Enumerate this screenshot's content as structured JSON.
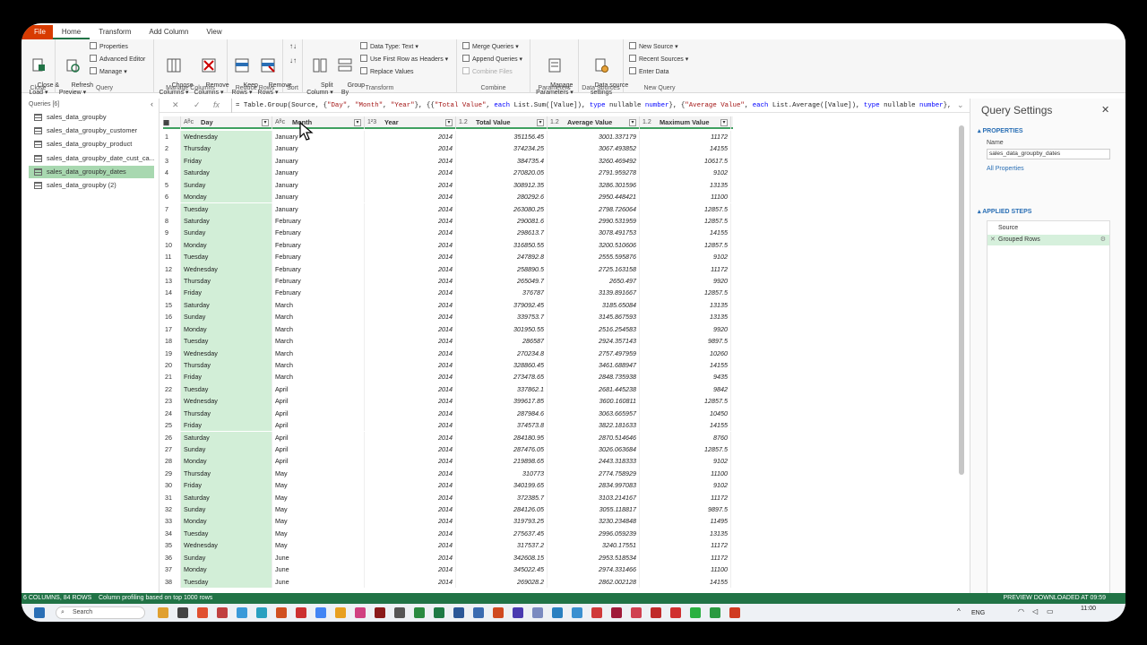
{
  "ribbon": {
    "tabs": [
      "File",
      "Home",
      "Transform",
      "Add Column",
      "View"
    ],
    "active_tab": "Home",
    "groups": {
      "close": {
        "label": "Close",
        "close_load": "Close &\nLoad ▾"
      },
      "query": {
        "label": "Query",
        "refresh": "Refresh\nPreview ▾",
        "properties": "Properties",
        "advanced_editor": "Advanced Editor",
        "manage": "Manage ▾"
      },
      "manage_columns": {
        "label": "Manage Columns",
        "choose": "Choose\nColumns ▾",
        "remove": "Remove\nColumns ▾"
      },
      "reduce_rows": {
        "label": "Reduce Rows",
        "keep": "Keep\nRows ▾",
        "remove": "Remove\nRows ▾"
      },
      "sort": {
        "label": "Sort"
      },
      "transform": {
        "label": "Transform",
        "split": "Split\nColumn ▾",
        "group": "Group\nBy",
        "data_type": "Data Type: Text ▾",
        "first_row": "Use First Row as Headers ▾",
        "replace": "Replace Values"
      },
      "combine": {
        "label": "Combine",
        "merge": "Merge Queries ▾",
        "append": "Append Queries ▾",
        "combine_files": "Combine Files"
      },
      "parameters": {
        "label": "Parameters",
        "manage": "Manage\nParameters ▾"
      },
      "data_sources": {
        "label": "Data Sources",
        "settings": "Data source\nsettings"
      },
      "new_query": {
        "label": "New Query",
        "new_source": "New Source ▾",
        "recent": "Recent Sources ▾",
        "enter": "Enter Data"
      }
    }
  },
  "formula_bar": {
    "fx": "fx",
    "formula_parts": [
      {
        "t": "= Table.Group(Source, {",
        "c": ""
      },
      {
        "t": "\"Day\"",
        "c": "s"
      },
      {
        "t": ", ",
        "c": ""
      },
      {
        "t": "\"Month\"",
        "c": "s"
      },
      {
        "t": ", ",
        "c": ""
      },
      {
        "t": "\"Year\"",
        "c": "s"
      },
      {
        "t": "}, {{",
        "c": ""
      },
      {
        "t": "\"Total Value\"",
        "c": "s"
      },
      {
        "t": ", ",
        "c": ""
      },
      {
        "t": "each",
        "c": "k"
      },
      {
        "t": " List.Sum([Value]), ",
        "c": ""
      },
      {
        "t": "type",
        "c": "k"
      },
      {
        "t": " nullable ",
        "c": ""
      },
      {
        "t": "number",
        "c": "k"
      },
      {
        "t": "}, {",
        "c": ""
      },
      {
        "t": "\"Average Value\"",
        "c": "s"
      },
      {
        "t": ", ",
        "c": ""
      },
      {
        "t": "each",
        "c": "k"
      },
      {
        "t": " List.Average([Value]), ",
        "c": ""
      },
      {
        "t": "type",
        "c": "k"
      },
      {
        "t": " nullable ",
        "c": ""
      },
      {
        "t": "number",
        "c": "k"
      },
      {
        "t": "},",
        "c": ""
      }
    ]
  },
  "queries": {
    "header": "Queries [6]",
    "items": [
      "sales_data_groupby",
      "sales_data_groupby_customer",
      "sales_data_groupby_product",
      "sales_data_groupby_date_cust_ca...",
      "sales_data_groupby_dates",
      "sales_data_groupby (2)"
    ],
    "selected": 4
  },
  "grid": {
    "columns": [
      {
        "type": "Aᴮᴄ",
        "name": "Day"
      },
      {
        "type": "Aᴮᴄ",
        "name": "Month"
      },
      {
        "type": "1²3",
        "name": "Year"
      },
      {
        "type": "1.2",
        "name": "Total Value"
      },
      {
        "type": "1.2",
        "name": "Average Value"
      },
      {
        "type": "1.2",
        "name": "Maximum Value"
      }
    ],
    "rows": [
      [
        "Wednesday",
        "January",
        "2014",
        "351156.45",
        "3001.337179",
        "11172"
      ],
      [
        "Thursday",
        "January",
        "2014",
        "374234.25",
        "3067.493852",
        "14155"
      ],
      [
        "Friday",
        "January",
        "2014",
        "384735.4",
        "3260.469492",
        "10617.5"
      ],
      [
        "Saturday",
        "January",
        "2014",
        "270820.05",
        "2791.959278",
        "9102"
      ],
      [
        "Sunday",
        "January",
        "2014",
        "308912.35",
        "3286.301596",
        "13135"
      ],
      [
        "Monday",
        "January",
        "2014",
        "280292.6",
        "2950.448421",
        "11100"
      ],
      [
        "Tuesday",
        "January",
        "2014",
        "263080.25",
        "2798.726064",
        "12857.5"
      ],
      [
        "Saturday",
        "February",
        "2014",
        "290081.6",
        "2990.531959",
        "12857.5"
      ],
      [
        "Sunday",
        "February",
        "2014",
        "298613.7",
        "3078.491753",
        "14155"
      ],
      [
        "Monday",
        "February",
        "2014",
        "316850.55",
        "3200.510606",
        "12857.5"
      ],
      [
        "Tuesday",
        "February",
        "2014",
        "247892.8",
        "2555.595876",
        "9102"
      ],
      [
        "Wednesday",
        "February",
        "2014",
        "258890.5",
        "2725.163158",
        "11172"
      ],
      [
        "Thursday",
        "February",
        "2014",
        "265049.7",
        "2650.497",
        "9920"
      ],
      [
        "Friday",
        "February",
        "2014",
        "376787",
        "3139.891667",
        "12857.5"
      ],
      [
        "Saturday",
        "March",
        "2014",
        "379092.45",
        "3185.65084",
        "13135"
      ],
      [
        "Sunday",
        "March",
        "2014",
        "339753.7",
        "3145.867593",
        "13135"
      ],
      [
        "Monday",
        "March",
        "2014",
        "301950.55",
        "2516.254583",
        "9920"
      ],
      [
        "Tuesday",
        "March",
        "2014",
        "286587",
        "2924.357143",
        "9897.5"
      ],
      [
        "Wednesday",
        "March",
        "2014",
        "270234.8",
        "2757.497959",
        "10260"
      ],
      [
        "Thursday",
        "March",
        "2014",
        "328860.45",
        "3461.688947",
        "14155"
      ],
      [
        "Friday",
        "March",
        "2014",
        "273478.65",
        "2848.735938",
        "9435"
      ],
      [
        "Tuesday",
        "April",
        "2014",
        "337862.1",
        "2681.445238",
        "9842"
      ],
      [
        "Wednesday",
        "April",
        "2014",
        "399617.85",
        "3600.160811",
        "12857.5"
      ],
      [
        "Thursday",
        "April",
        "2014",
        "287984.6",
        "3063.665957",
        "10450"
      ],
      [
        "Friday",
        "April",
        "2014",
        "374573.8",
        "3822.181633",
        "14155"
      ],
      [
        "Saturday",
        "April",
        "2014",
        "284180.95",
        "2870.514646",
        "8760"
      ],
      [
        "Sunday",
        "April",
        "2014",
        "287476.05",
        "3026.063684",
        "12857.5"
      ],
      [
        "Monday",
        "April",
        "2014",
        "219898.65",
        "2443.318333",
        "9102"
      ],
      [
        "Thursday",
        "May",
        "2014",
        "310773",
        "2774.758929",
        "11100"
      ],
      [
        "Friday",
        "May",
        "2014",
        "340199.65",
        "2834.997083",
        "9102"
      ],
      [
        "Saturday",
        "May",
        "2014",
        "372385.7",
        "3103.214167",
        "11172"
      ],
      [
        "Sunday",
        "May",
        "2014",
        "284126.05",
        "3055.118817",
        "9897.5"
      ],
      [
        "Monday",
        "May",
        "2014",
        "319793.25",
        "3230.234848",
        "11495"
      ],
      [
        "Tuesday",
        "May",
        "2014",
        "275637.45",
        "2996.059239",
        "13135"
      ],
      [
        "Wednesday",
        "May",
        "2014",
        "317537.2",
        "3240.17551",
        "11172"
      ],
      [
        "Sunday",
        "June",
        "2014",
        "342608.15",
        "2953.518534",
        "11172"
      ],
      [
        "Monday",
        "June",
        "2014",
        "345022.45",
        "2974.331466",
        "11100"
      ],
      [
        "Tuesday",
        "June",
        "2014",
        "269028.2",
        "2862.002128",
        "14155"
      ]
    ]
  },
  "settings": {
    "title": "Query Settings",
    "properties_label": "PROPERTIES",
    "name_label": "Name",
    "name_value": "sales_data_groupby_dates",
    "all_properties": "All Properties",
    "applied_steps_label": "APPLIED STEPS",
    "steps": [
      "Source",
      "Grouped Rows"
    ],
    "selected_step": 1
  },
  "status": {
    "left": "6 COLUMNS, 84 ROWS",
    "profiling": "Column profiling based on top 1000 rows",
    "right": "PREVIEW DOWNLOADED AT 09:59"
  },
  "taskbar": {
    "search": "Search",
    "lang": "ENG",
    "time": "11:00"
  },
  "colors": {
    "accent": "#217346",
    "file_tab": "#d83b01",
    "selected_query": "#a8d8b0"
  }
}
